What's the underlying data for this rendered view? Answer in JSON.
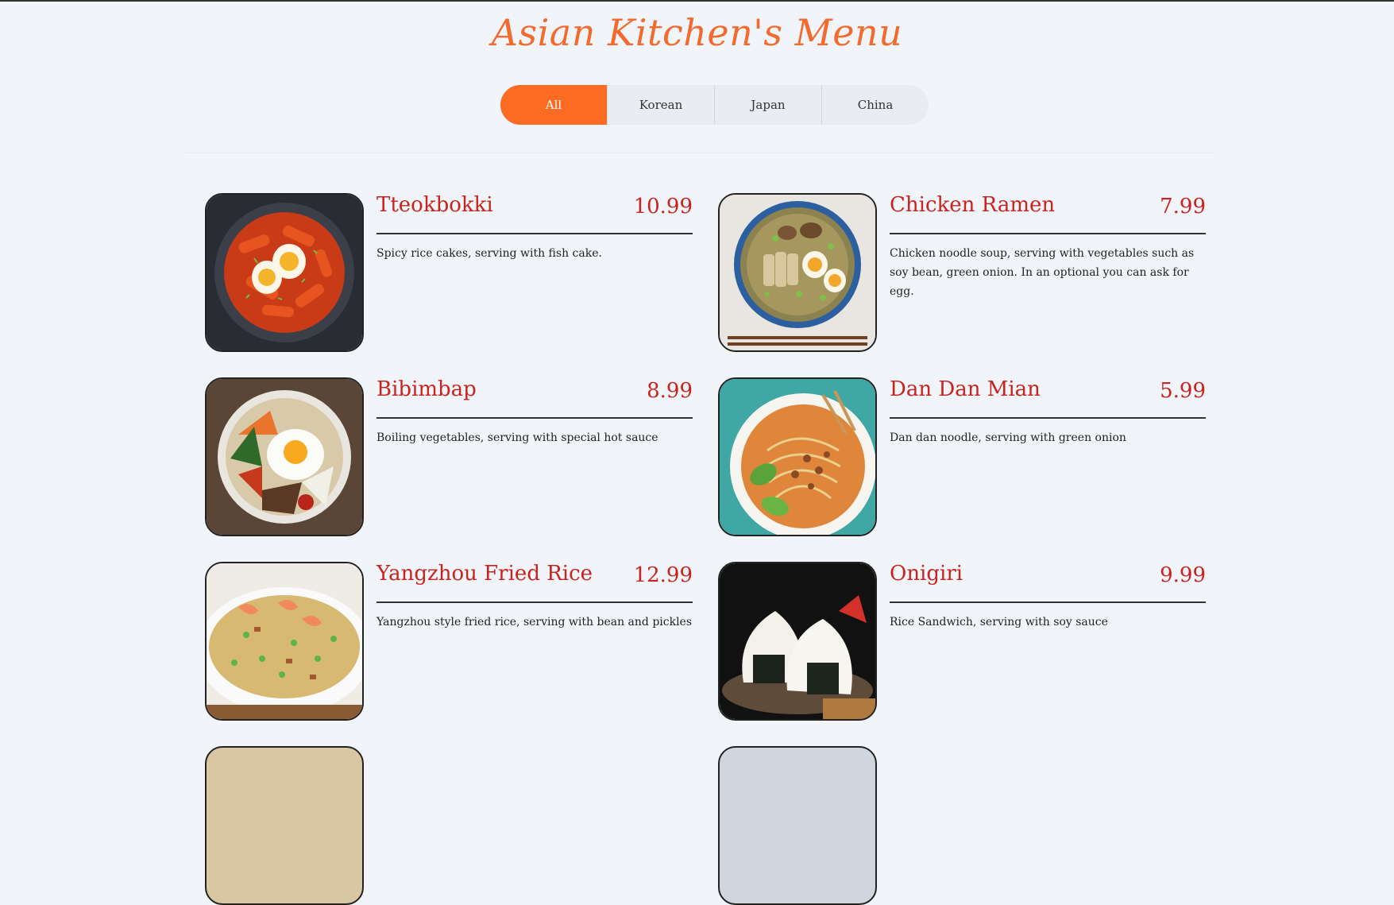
{
  "title": "Asian Kitchen's Menu",
  "tabs": [
    {
      "label": "All",
      "active": true
    },
    {
      "label": "Korean",
      "active": false
    },
    {
      "label": "Japan",
      "active": false
    },
    {
      "label": "China",
      "active": false
    }
  ],
  "items": [
    {
      "name": "Tteokbokki",
      "price": "10.99",
      "desc": "Spicy rice cakes, serving with fish cake.",
      "image": "tteokbokki-image"
    },
    {
      "name": "Chicken Ramen",
      "price": "7.99",
      "desc": "Chicken noodle soup, serving with vegetables such as soy bean, green onion. In an optional you can ask for egg.",
      "image": "chicken-ramen-image"
    },
    {
      "name": "Bibimbap",
      "price": "8.99",
      "desc": "Boiling vegetables, serving with special hot sauce",
      "image": "bibimbap-image"
    },
    {
      "name": "Dan Dan Mian",
      "price": "5.99",
      "desc": "Dan dan noodle, serving with green onion",
      "image": "dan-dan-mian-image"
    },
    {
      "name": "Yangzhou Fried Rice",
      "price": "12.99",
      "desc": "Yangzhou style fried rice, serving with bean and pickles",
      "image": "fried-rice-image"
    },
    {
      "name": "Onigiri",
      "price": "9.99",
      "desc": "Rice Sandwich, serving with soy sauce",
      "image": "onigiri-image"
    }
  ],
  "colors": {
    "accent": "#fb6b22",
    "title": "#f26a2e",
    "item_text": "#c8231e",
    "background": "#f1f4f8"
  }
}
